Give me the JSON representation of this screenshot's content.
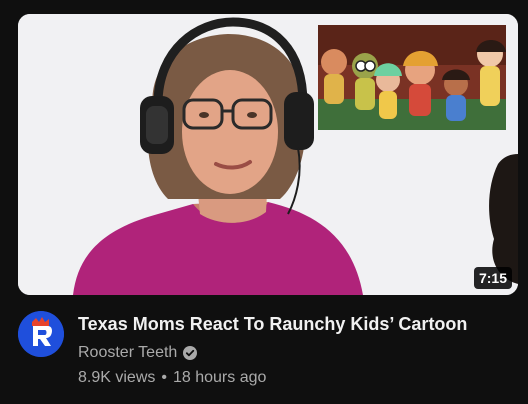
{
  "video": {
    "title": "Texas Moms React To Raunchy Kids’ Cartoon",
    "duration": "7:15",
    "views": "8.9K views",
    "separator": "•",
    "age": "18 hours ago"
  },
  "channel": {
    "name": "Rooster Teeth",
    "verified": true,
    "avatar_icon": "rooster-teeth-logo",
    "brand_color": "#1f4fdc"
  },
  "icons": {
    "verified": "verified-check-icon"
  }
}
